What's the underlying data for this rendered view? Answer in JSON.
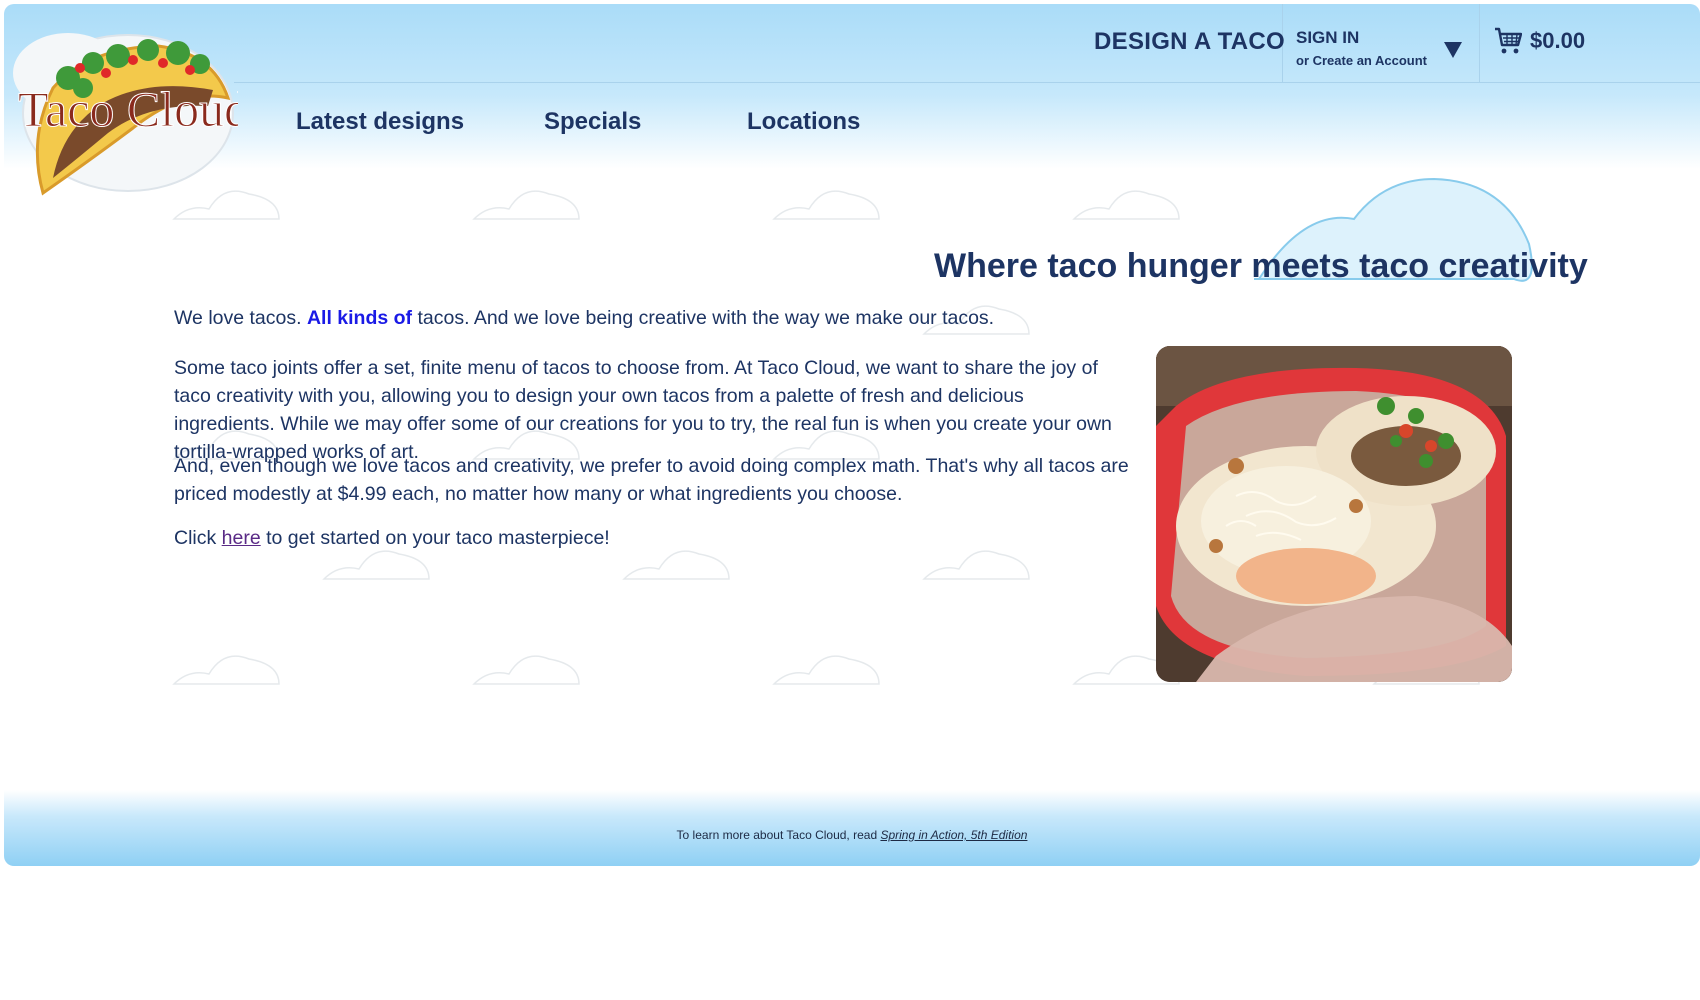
{
  "header": {
    "logo_text": "Taco Cloud",
    "design_link": "DESIGN A TACO",
    "sign_in": "SIGN IN",
    "create_account": "or Create an Account",
    "cart_total": "$0.00"
  },
  "nav": {
    "items": [
      {
        "label": "Latest designs"
      },
      {
        "label": "Specials"
      },
      {
        "label": "Locations"
      }
    ]
  },
  "main": {
    "headline": "Where taco hunger meets taco creativity",
    "p1": {
      "before": "We love tacos. ",
      "highlight": "All kinds of",
      "after": " tacos. And we love being creative with the way we make our tacos."
    },
    "p2": "Some taco joints offer a set, finite menu of tacos to choose from. At Taco Cloud, we want to share the joy of taco creativity with you, allowing you to design your own tacos from a palette of fresh and delicious ingredients. While we may offer some of our creations for you to try, the real fun is when you create your own tortilla-wrapped works of art.",
    "p3": "And, even though we love tacos and creativity, we prefer to avoid doing complex math. That's why all tacos are priced modestly at $4.99 each, no matter how many or what ingredients you choose.",
    "p4": {
      "before": "Click ",
      "link": "here",
      "after": " to get started on your taco masterpiece!"
    }
  },
  "footer": {
    "text": "To learn more about Taco Cloud, read ",
    "link": "Spring in Action, 5th Edition"
  },
  "colors": {
    "text_primary": "#1d3463",
    "highlight": "#1a1ae6",
    "header_sky": "#aadcf8",
    "footer_sky": "#8fd0f4"
  },
  "icons": {
    "cart": "shopping-cart-icon",
    "dropdown": "chevron-down-icon"
  }
}
